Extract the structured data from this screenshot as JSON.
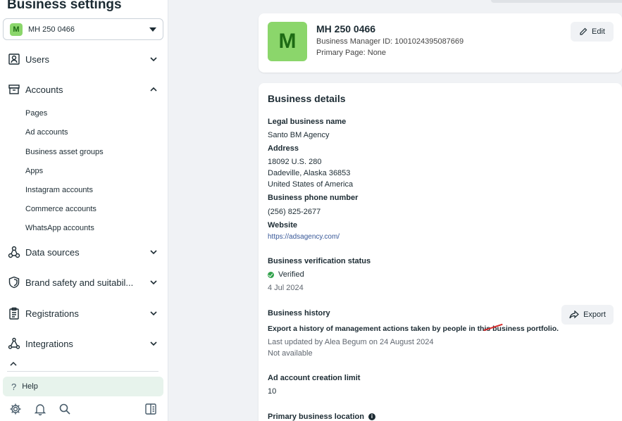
{
  "sidebar": {
    "title": "Business settings",
    "account": {
      "badge": "M",
      "name": "MH 250 0466"
    },
    "nav": {
      "users": "Users",
      "accounts": "Accounts",
      "data_sources": "Data sources",
      "brand_safety": "Brand safety and suitabil...",
      "registrations": "Registrations",
      "integrations": "Integrations"
    },
    "accounts_sub": [
      "Pages",
      "Ad accounts",
      "Business asset groups",
      "Apps",
      "Instagram accounts",
      "Commerce accounts",
      "WhatsApp accounts"
    ],
    "help": "Help"
  },
  "profile": {
    "badge": "M",
    "name": "MH 250 0466",
    "manager_id": "Business Manager ID: 1001024395087669",
    "primary_page": "Primary Page: None",
    "edit_label": "Edit"
  },
  "details": {
    "heading": "Business details",
    "legal_name_label": "Legal business name",
    "legal_name": "Santo BM Agency",
    "address_label": "Address",
    "address_line1": "18092 U.S. 280",
    "address_line2": "Dadeville, Alaska 36853",
    "address_line3": "United States of America",
    "phone_label": "Business phone number",
    "phone": "(256) 825-2677",
    "website_label": "Website",
    "website": "https://adsagency.com/",
    "verification_label": "Business verification status",
    "verification_status": "Verified",
    "verification_date": "4 Jul 2024",
    "history_label": "Business history",
    "history_desc": "Export a history of management actions taken by people in this business portfolio.",
    "history_updated": "Last updated by Alea Begum on 24 August 2024",
    "history_availability": "Not available",
    "export_label": "Export",
    "ad_limit_label": "Ad account creation limit",
    "ad_limit": "10",
    "location_label": "Primary business location"
  },
  "colors": {
    "brand_badge": "#8bd66b",
    "verified": "#31a24c",
    "link": "#385898",
    "help_bg": "#e7f3ec"
  }
}
